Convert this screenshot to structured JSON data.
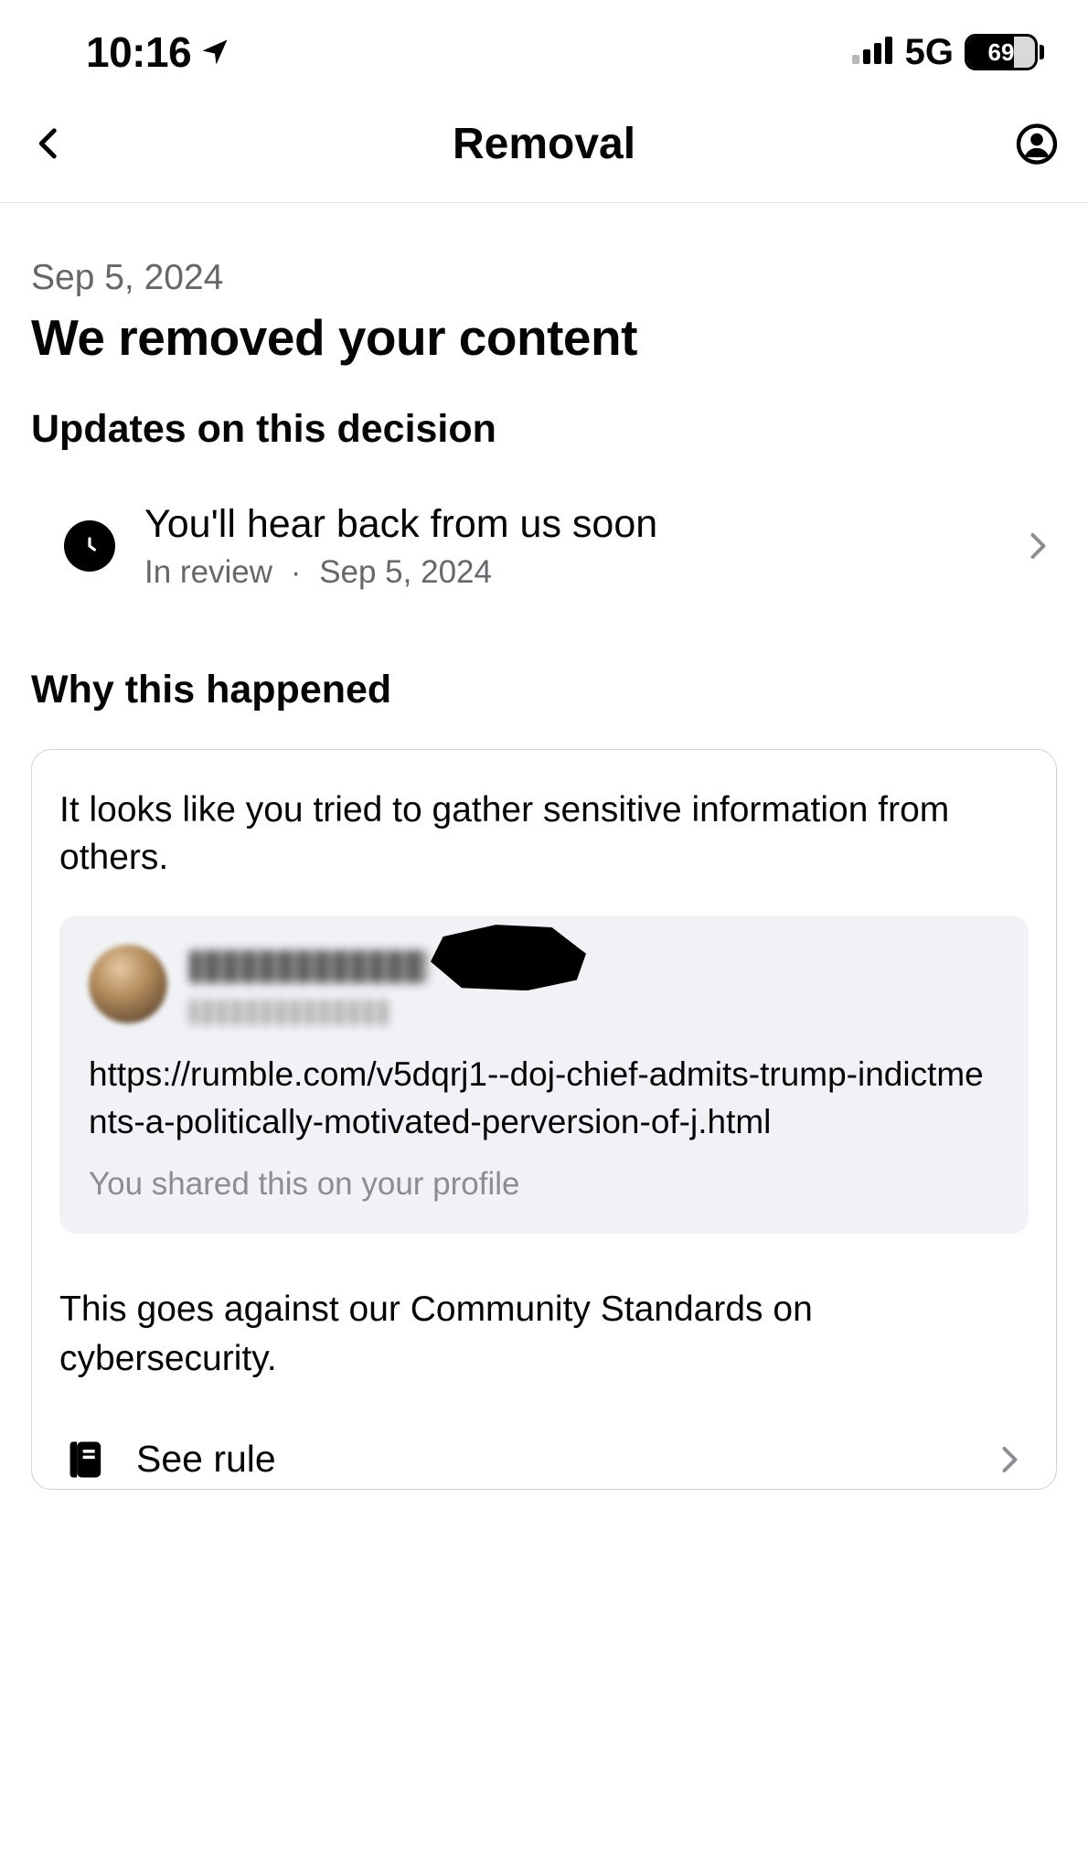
{
  "status_bar": {
    "time": "10:16",
    "network_label": "5G",
    "battery_percent": "69"
  },
  "nav": {
    "title": "Removal"
  },
  "page": {
    "date": "Sep 5, 2024",
    "headline": "We removed your content",
    "updates_heading": "Updates on this decision",
    "update": {
      "title": "You'll hear back from us soon",
      "status": "In review",
      "date": "Sep 5, 2024"
    },
    "why_heading": "Why this happened",
    "card": {
      "lead": "It looks like you tried to gather sensitive information from others.",
      "post": {
        "link_text": "https://rumble.com/v5dqrj1--doj-chief-admits-trump-indictments-a-politically-motivated-perversion-of-j.html",
        "shared_where": "You shared this on your profile"
      },
      "standards_text": "This goes against our Community Standards on cybersecurity.",
      "see_rule_label": "See rule"
    }
  }
}
